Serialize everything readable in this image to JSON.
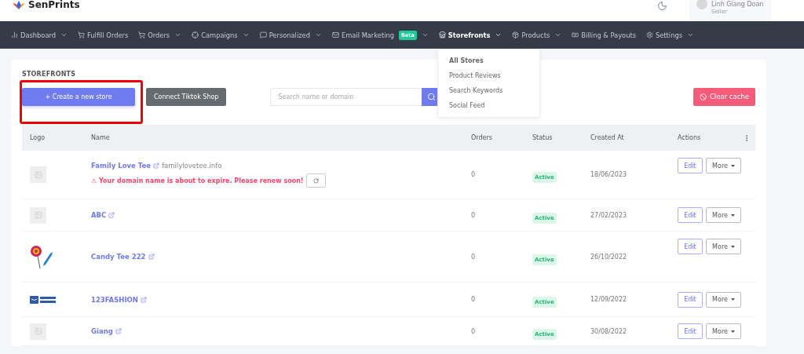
{
  "brand": {
    "name": "SenPrints"
  },
  "user": {
    "name": "Linh Giang Doan",
    "role": "Seller"
  },
  "nav": [
    {
      "label": "Dashboard",
      "caret": true,
      "selected": false
    },
    {
      "label": "Fulfill Orders",
      "caret": false,
      "selected": false
    },
    {
      "label": "Orders",
      "caret": true,
      "selected": false
    },
    {
      "label": "Campaigns",
      "caret": true,
      "selected": false
    },
    {
      "label": "Personalized",
      "caret": true,
      "selected": false
    },
    {
      "label": "Email Marketing",
      "caret": true,
      "selected": false,
      "badge": "Beta"
    },
    {
      "label": "Storefronts",
      "caret": true,
      "selected": true
    },
    {
      "label": "Products",
      "caret": true,
      "selected": false
    },
    {
      "label": "Billing & Payouts",
      "caret": false,
      "selected": false
    },
    {
      "label": "Settings",
      "caret": true,
      "selected": false
    }
  ],
  "dropdown": [
    {
      "label": "All Stores",
      "selected": true
    },
    {
      "label": "Product Reviews",
      "selected": false
    },
    {
      "label": "Search Keywords",
      "selected": false
    },
    {
      "label": "Social Feed",
      "selected": false
    }
  ],
  "page_title": "STOREFRONTS",
  "create_button": "+ Create a new store",
  "connect_button": "Connect Tiktok Shop",
  "search": {
    "placeholder": "Search name or domain"
  },
  "clear_button": "Clear cache",
  "table": {
    "columns": [
      "Logo",
      "Name",
      "Orders",
      "Status",
      "Created At",
      "Actions"
    ],
    "rows": [
      {
        "kind": "placeholder",
        "name": "Family Love Tee",
        "domain": "familylovetee.info",
        "warning": "⚠ Your domain name is about to expire. Please renew soon!",
        "orders": "0",
        "status": "Active",
        "created": "18/06/2023",
        "edit": "Edit",
        "more": "More"
      },
      {
        "kind": "placeholder",
        "name": "ABC",
        "orders": "0",
        "status": "Active",
        "created": "27/02/2023",
        "edit": "Edit",
        "more": "More"
      },
      {
        "kind": "candy",
        "name": "Candy Tee 222",
        "orders": "0",
        "status": "Active",
        "created": "26/10/2022",
        "edit": "Edit",
        "more": "More"
      },
      {
        "kind": "launch",
        "name": "123FASHION",
        "orders": "0",
        "status": "Active",
        "created": "12/09/2022",
        "edit": "Edit",
        "more": "More"
      },
      {
        "kind": "placeholder",
        "name": "Giang",
        "orders": "0",
        "status": "Active",
        "created": "30/08/2022",
        "edit": "Edit",
        "more": "More"
      }
    ]
  }
}
